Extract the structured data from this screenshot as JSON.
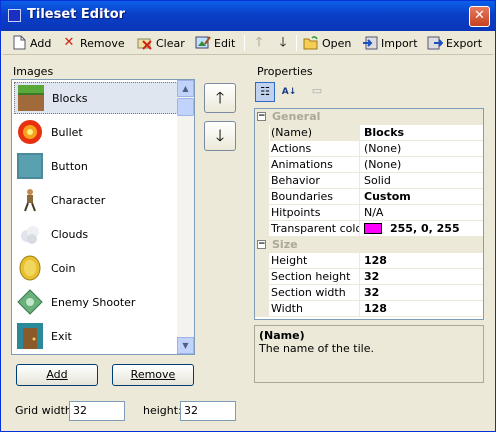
{
  "window": {
    "title": "Tileset Editor",
    "close_glyph": "✕"
  },
  "colors": {
    "titlebar": "#0a4fd8",
    "transparent_color": "#ff00ff",
    "selection": "#dfe6ef"
  },
  "toolbar": {
    "add": "Add",
    "remove": "Remove",
    "clear": "Clear",
    "edit": "Edit",
    "open": "Open",
    "import": "Import",
    "export": "Export"
  },
  "images": {
    "label": "Images",
    "items": [
      {
        "name": "Blocks",
        "icon": "blocks-thumb"
      },
      {
        "name": "Bullet",
        "icon": "bullet-thumb"
      },
      {
        "name": "Button",
        "icon": "button-thumb"
      },
      {
        "name": "Character",
        "icon": "character-thumb"
      },
      {
        "name": "Clouds",
        "icon": "clouds-thumb"
      },
      {
        "name": "Coin",
        "icon": "coin-thumb"
      },
      {
        "name": "Enemy Shooter",
        "icon": "enemy-shooter-thumb"
      },
      {
        "name": "Exit",
        "icon": "exit-thumb"
      }
    ],
    "selected": "Blocks",
    "add_button": "Add",
    "remove_button": "Remove"
  },
  "grid_size": {
    "width_label": "Grid width:",
    "width_value": "32",
    "height_label": "height:",
    "height_value": "32"
  },
  "properties": {
    "label": "Properties",
    "general": {
      "title": "General",
      "rows": [
        {
          "name": "(Name)",
          "value": "Blocks"
        },
        {
          "name": "Actions",
          "value": "(None)"
        },
        {
          "name": "Animations",
          "value": "(None)"
        },
        {
          "name": "Behavior",
          "value": "Solid"
        },
        {
          "name": "Boundaries",
          "value": "Custom"
        },
        {
          "name": "Hitpoints",
          "value": "N/A"
        },
        {
          "name": "Transparent color",
          "value": "255, 0, 255"
        }
      ]
    },
    "size": {
      "title": "Size",
      "rows": [
        {
          "name": "Height",
          "value": "128"
        },
        {
          "name": "Section height",
          "value": "32"
        },
        {
          "name": "Section width",
          "value": "32"
        },
        {
          "name": "Width",
          "value": "128"
        }
      ]
    },
    "description": {
      "title": "(Name)",
      "text": "The name of the tile."
    }
  }
}
